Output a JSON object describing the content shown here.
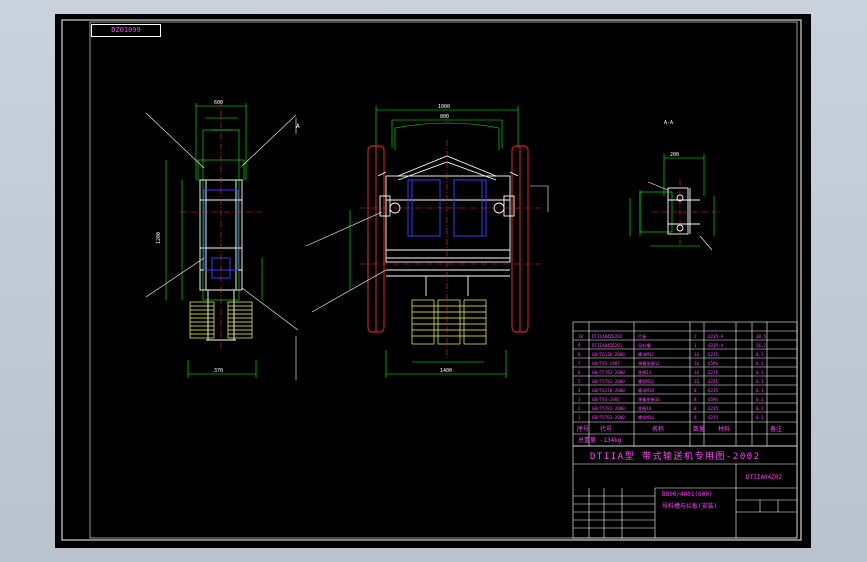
{
  "drawing": {
    "stamp_code": "DZ01099",
    "title_product": "DTIIA型 带式输送机专用图-2002",
    "sheet_code": "DTIIA04Z02",
    "part_line1": "B800/4001(600)",
    "part_line2": "导料槽与拦板(安装)",
    "weight_note": "总重量 -134kg",
    "section_mark": "A",
    "section_view": "A-A"
  },
  "bom": {
    "headers": [
      "序号",
      "代号",
      "名称",
      "数量",
      "材料",
      "备注"
    ],
    "rows": [
      {
        "no": "1",
        "code": "GB/T5783-2000",
        "name": "螺栓M16",
        "qty": "8",
        "mat": "Q235",
        "note": "0.1"
      },
      {
        "no": "2",
        "code": "GB/T5783-2000",
        "name": "垫圈16",
        "qty": "8",
        "mat": "Q235",
        "note": "0.1"
      },
      {
        "no": "3",
        "code": "GB/T93-1987",
        "name": "弹簧垫圈16",
        "qty": "8",
        "mat": "65Mn",
        "note": "0.1"
      },
      {
        "no": "4",
        "code": "GB/T6170-2000",
        "name": "螺母M16",
        "qty": "8",
        "mat": "Q235",
        "note": "0.1"
      },
      {
        "no": "5",
        "code": "GB/T5783-2000",
        "name": "螺栓M12",
        "qty": "16",
        "mat": "Q235",
        "note": "0.1"
      },
      {
        "no": "6",
        "code": "GB/T5783-2000",
        "name": "垫圈12",
        "qty": "16",
        "mat": "Q235",
        "note": "0.1"
      },
      {
        "no": "7",
        "code": "GB/T93-1987",
        "name": "弹簧垫圈12",
        "qty": "16",
        "mat": "65Mn",
        "note": "0.1"
      },
      {
        "no": "8",
        "code": "GB/T6170-2000",
        "name": "螺母M12",
        "qty": "16",
        "mat": "Q235",
        "note": "0.1"
      },
      {
        "no": "9",
        "code": "DTIIA04Z0201",
        "name": "导料槽",
        "qty": "1",
        "mat": "Q235-A",
        "note": "56.2"
      },
      {
        "no": "10",
        "code": "DTIIA04Z0202",
        "name": "拦板",
        "qty": "2",
        "mat": "Q235-A",
        "note": "38.5"
      }
    ]
  },
  "dims": {
    "top_width": "1000",
    "top_inner": "800",
    "side_width": "600",
    "side_height": "1200",
    "bottom_width": "1400",
    "side_bottom": "370",
    "detail_width": "200"
  }
}
